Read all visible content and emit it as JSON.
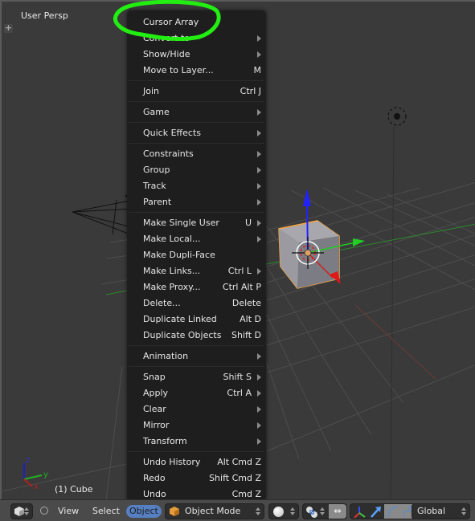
{
  "viewport": {
    "view_label": "User Persp",
    "object_label": "(1) Cube",
    "axis_labels": {
      "x": "x",
      "y": "y",
      "z": "z"
    }
  },
  "menu": {
    "items": [
      {
        "label": "Cursor Array",
        "shortcut": "",
        "submenu": false,
        "annotated": true
      },
      {
        "label": "Convert to",
        "shortcut": "",
        "submenu": true
      },
      {
        "label": "Show/Hide",
        "shortcut": "",
        "submenu": true
      },
      {
        "label": "Move to Layer...",
        "shortcut": "M",
        "submenu": false
      },
      {
        "separator": true
      },
      {
        "label": "Join",
        "shortcut": "Ctrl J",
        "submenu": false
      },
      {
        "separator": true
      },
      {
        "label": "Game",
        "shortcut": "",
        "submenu": true
      },
      {
        "separator": true
      },
      {
        "label": "Quick Effects",
        "shortcut": "",
        "submenu": true
      },
      {
        "separator": true
      },
      {
        "label": "Constraints",
        "shortcut": "",
        "submenu": true
      },
      {
        "label": "Group",
        "shortcut": "",
        "submenu": true
      },
      {
        "label": "Track",
        "shortcut": "",
        "submenu": true
      },
      {
        "label": "Parent",
        "shortcut": "",
        "submenu": true
      },
      {
        "separator": true
      },
      {
        "label": "Make Single User",
        "shortcut": "U",
        "submenu": true
      },
      {
        "label": "Make Local...",
        "shortcut": "",
        "submenu": true
      },
      {
        "label": "Make Dupli-Face",
        "shortcut": "",
        "submenu": false
      },
      {
        "label": "Make Links...",
        "shortcut": "Ctrl L",
        "submenu": true
      },
      {
        "label": "Make Proxy...",
        "shortcut": "Ctrl Alt P",
        "submenu": false
      },
      {
        "label": "Delete...",
        "shortcut": "Delete",
        "submenu": false
      },
      {
        "label": "Duplicate Linked",
        "shortcut": "Alt D",
        "submenu": false
      },
      {
        "label": "Duplicate Objects",
        "shortcut": "Shift D",
        "submenu": false
      },
      {
        "separator": true
      },
      {
        "label": "Animation",
        "shortcut": "",
        "submenu": true
      },
      {
        "separator": true
      },
      {
        "label": "Snap",
        "shortcut": "Shift S",
        "submenu": true
      },
      {
        "label": "Apply",
        "shortcut": "Ctrl A",
        "submenu": true
      },
      {
        "label": "Clear",
        "shortcut": "",
        "submenu": true
      },
      {
        "label": "Mirror",
        "shortcut": "",
        "submenu": true
      },
      {
        "label": "Transform",
        "shortcut": "",
        "submenu": true
      },
      {
        "separator": true
      },
      {
        "label": "Undo History",
        "shortcut": "Alt Cmd Z",
        "submenu": false
      },
      {
        "label": "Redo",
        "shortcut": "Shift Cmd Z",
        "submenu": false
      },
      {
        "label": "Undo",
        "shortcut": "Cmd Z",
        "submenu": false
      }
    ]
  },
  "header": {
    "menus": [
      "View",
      "Select",
      "Object"
    ],
    "active_menu": "Object",
    "mode": "Object Mode",
    "orientation": "Global",
    "editor_icon": "cube-icon",
    "shading_icon": "solid-sphere-icon",
    "pivot_icon": "pivot-median-icon",
    "accent_color": "#5680c2"
  },
  "colors": {
    "annotation": "#22ee11",
    "selection_outline": "#f5a442"
  }
}
